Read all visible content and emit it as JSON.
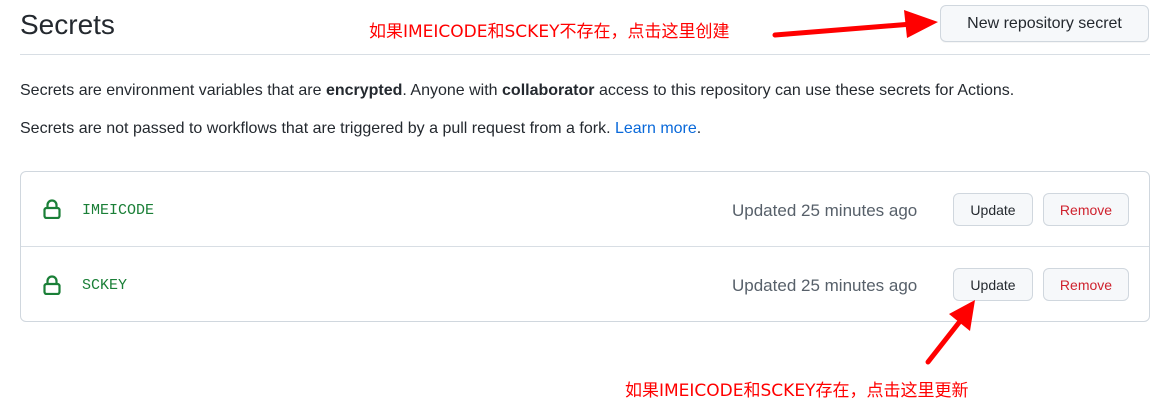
{
  "header": {
    "title": "Secrets",
    "new_secret_label": "New repository secret"
  },
  "description": {
    "line1_part1": "Secrets are environment variables that are ",
    "line1_bold1": "encrypted",
    "line1_part2": ". Anyone with ",
    "line1_bold2": "collaborator",
    "line1_part3": " access to this repository can use these secrets for Actions.",
    "line2_text": "Secrets are not passed to workflows that are triggered by a pull request from a fork. ",
    "line2_link": "Learn more",
    "line2_end": "."
  },
  "secrets": [
    {
      "name": "IMEICODE",
      "updated": "Updated 25 minutes ago",
      "update_label": "Update",
      "remove_label": "Remove"
    },
    {
      "name": "SCKEY",
      "updated": "Updated 25 minutes ago",
      "update_label": "Update",
      "remove_label": "Remove"
    }
  ],
  "annotations": {
    "top": "如果IMEICODE和SCKEY不存在，点击这里创建",
    "bottom": "如果IMEICODE和SCKEY存在，点击这里更新"
  },
  "colors": {
    "secret_name": "#1a7f37",
    "link": "#0969da",
    "remove": "#cf222e",
    "annotation": "#ff0000"
  },
  "icons": {
    "secret": "lock-icon",
    "annotation": "red-arrow-icon"
  }
}
